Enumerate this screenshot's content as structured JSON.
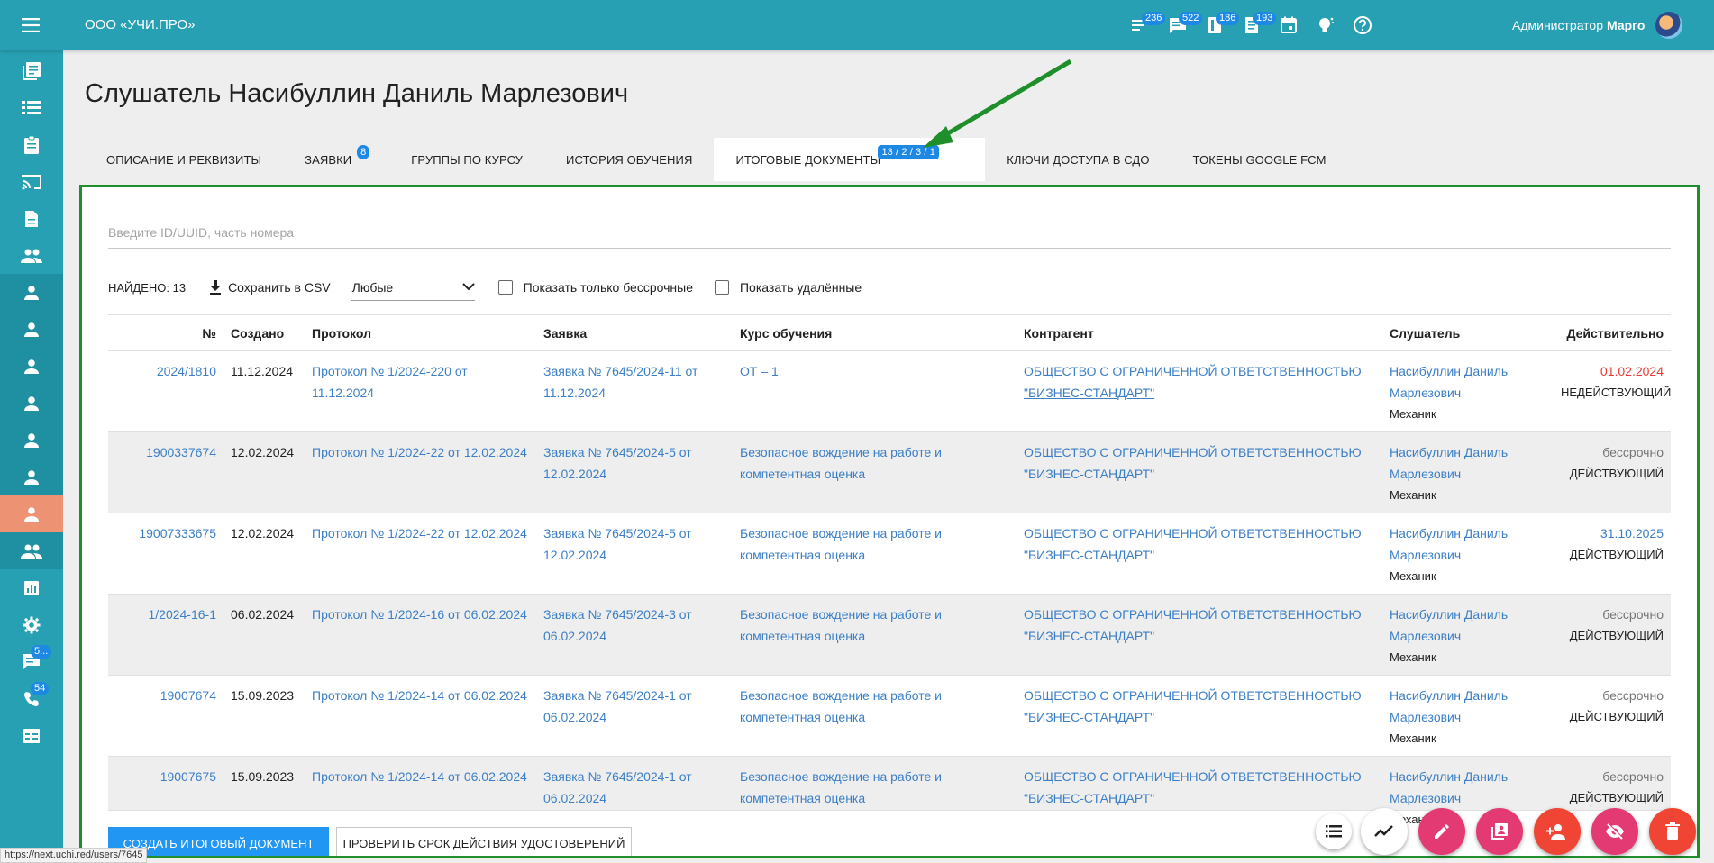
{
  "header": {
    "org_name": "ООО «УЧИ.ПРО»",
    "icons": [
      {
        "icon": "list-icon",
        "badge": "236"
      },
      {
        "icon": "chat-icon",
        "badge": "522"
      },
      {
        "icon": "book-icon",
        "badge": "186"
      },
      {
        "icon": "document-icon",
        "badge": "193"
      },
      {
        "icon": "calendar-icon",
        "badge": ""
      },
      {
        "icon": "lightbulb-icon",
        "badge": ""
      },
      {
        "icon": "help-icon",
        "badge": ""
      }
    ],
    "user_role": "Администратор",
    "user_name": "Марго"
  },
  "sidebar": {
    "items": [
      {
        "icon": "library-icon"
      },
      {
        "icon": "list-icon"
      },
      {
        "icon": "clipboard-icon"
      },
      {
        "icon": "cast-icon"
      },
      {
        "icon": "file-icon"
      },
      {
        "icon": "people-icon"
      },
      {
        "icon": "person-icon"
      },
      {
        "icon": "person-icon"
      },
      {
        "icon": "person-icon"
      },
      {
        "icon": "person-icon"
      },
      {
        "icon": "person-icon"
      },
      {
        "icon": "person-icon"
      },
      {
        "icon": "person-icon",
        "active": true
      },
      {
        "icon": "people-icon"
      },
      {
        "icon": "chart-icon"
      },
      {
        "icon": "settings-icon"
      },
      {
        "icon": "chat-icon",
        "badge": "5..."
      },
      {
        "icon": "phone-icon",
        "badge": "54"
      },
      {
        "icon": "table-icon"
      }
    ]
  },
  "page": {
    "title": "Слушатель Насибуллин Даниль Марлезович"
  },
  "tabs": [
    {
      "label": "Описание и реквизиты",
      "badge": ""
    },
    {
      "label": "Заявки",
      "badge": "8"
    },
    {
      "label": "Группы по курсу",
      "badge": ""
    },
    {
      "label": "История обучения",
      "badge": ""
    },
    {
      "label": "Итоговые документы",
      "badge": "13 / 2 / 3 / 1",
      "active": true
    },
    {
      "label": "Ключи доступа в СДО",
      "badge": ""
    },
    {
      "label": "Токены Google FCM",
      "badge": ""
    }
  ],
  "search": {
    "placeholder": "Введите ID/UUID, часть номера"
  },
  "toolbar": {
    "found": "НАЙДЕНО: 13",
    "csv_label": "Сохранить в CSV",
    "select_value": "Любые",
    "only_perpetual": "Показать только бессрочные",
    "show_deleted": "Показать удалённые"
  },
  "table": {
    "headers": [
      "№",
      "Создано",
      "Протокол",
      "Заявка",
      "Курс обучения",
      "Контрагент",
      "Слушатель",
      "Действительно"
    ],
    "rows": [
      {
        "num": "2024/1810",
        "created": "11.12.2024",
        "protocol": "Протокол № 1/2024-220 от 11.12.2024",
        "request": "Заявка № 7645/2024-11 от 11.12.2024",
        "course": "ОТ – 1",
        "contractor": "ОБЩЕСТВО С ОГРАНИЧЕННОЙ ОТВЕТСТВЕННОСТЬЮ \"БИЗНЕС-СТАНДАРТ\"",
        "listener": "Насибуллин Даниль Марлезович",
        "position": "Механик",
        "valid": "01.02.2024",
        "valid_style": "red",
        "status": "НЕДЕЙСТВУЮЩИЙ"
      },
      {
        "num": "1900337674",
        "created": "12.02.2024",
        "protocol": "Протокол № 1/2024-22 от 12.02.2024",
        "request": "Заявка № 7645/2024-5 от 12.02.2024",
        "course": "Безопасное вождение на работе и компетентная оценка",
        "contractor": "ОБЩЕСТВО С ОГРАНИЧЕННОЙ ОТВЕТСТВЕННОСТЬЮ \"БИЗНЕС-СТАНДАРТ\"",
        "listener": "Насибуллин Даниль Марлезович",
        "position": "Механик",
        "valid": "бессрочно",
        "valid_style": "grey",
        "status": "ДЕЙСТВУЮЩИЙ"
      },
      {
        "num": "19007333675",
        "created": "12.02.2024",
        "protocol": "Протокол № 1/2024-22 от 12.02.2024",
        "request": "Заявка № 7645/2024-5 от 12.02.2024",
        "course": "Безопасное вождение на работе и компетентная оценка",
        "contractor": "ОБЩЕСТВО С ОГРАНИЧЕННОЙ ОТВЕТСТВЕННОСТЬЮ \"БИЗНЕС-СТАНДАРТ\"",
        "listener": "Насибуллин Даниль Марлезович",
        "position": "Механик",
        "valid": "31.10.2025",
        "valid_style": "blue",
        "status": "ДЕЙСТВУЮЩИЙ"
      },
      {
        "num": "1/2024-16-1",
        "created": "06.02.2024",
        "protocol": "Протокол № 1/2024-16 от 06.02.2024",
        "request": "Заявка № 7645/2024-3 от 06.02.2024",
        "course": "Безопасное вождение на работе и компетентная оценка",
        "contractor": "ОБЩЕСТВО С ОГРАНИЧЕННОЙ ОТВЕТСТВЕННОСТЬЮ \"БИЗНЕС-СТАНДАРТ\"",
        "listener": "Насибуллин Даниль Марлезович",
        "position": "Механик",
        "valid": "бессрочно",
        "valid_style": "grey",
        "status": "ДЕЙСТВУЮЩИЙ"
      },
      {
        "num": "19007674",
        "created": "15.09.2023",
        "protocol": "Протокол № 1/2024-14 от 06.02.2024",
        "request": "Заявка № 7645/2024-1 от 06.02.2024",
        "course": "Безопасное вождение на работе и компетентная оценка",
        "contractor": "ОБЩЕСТВО С ОГРАНИЧЕННОЙ ОТВЕТСТВЕННОСТЬЮ \"БИЗНЕС-СТАНДАРТ\"",
        "listener": "Насибуллин Даниль Марлезович",
        "position": "Механик",
        "valid": "бессрочно",
        "valid_style": "grey",
        "status": "ДЕЙСТВУЮЩИЙ"
      },
      {
        "num": "19007675",
        "created": "15.09.2023",
        "protocol": "Протокол № 1/2024-14 от 06.02.2024",
        "request": "Заявка № 7645/2024-1 от 06.02.2024",
        "course": "Безопасное вождение на работе и компетентная оценка",
        "contractor": "ОБЩЕСТВО С ОГРАНИЧЕННОЙ ОТВЕТСТВЕННОСТЬЮ \"БИЗНЕС-СТАНДАРТ\"",
        "listener": "Насибуллин Даниль Марлезович",
        "position": "Механик",
        "valid": "бессрочно",
        "valid_style": "grey",
        "status": "ДЕЙСТВУЮЩИЙ"
      }
    ]
  },
  "buttons": {
    "create": "Создать итоговый документ",
    "check": "Проверить срок действия удостоверений"
  },
  "fabs": [
    "list-icon",
    "trend-icon",
    "edit-icon",
    "library-add-icon",
    "person-add-icon",
    "visibility-off-icon",
    "delete-icon"
  ],
  "statusbar": {
    "url": "https://next.uchi.red/users/7645"
  },
  "colors": {
    "primary": "#27a0b3",
    "active_sidebar": "#ee9274",
    "link": "#3c7fc6",
    "badge": "#1e88e5",
    "highlight_border": "#1e8f2a",
    "fab_pink": "#e43a74",
    "fab_red": "#f04535"
  }
}
